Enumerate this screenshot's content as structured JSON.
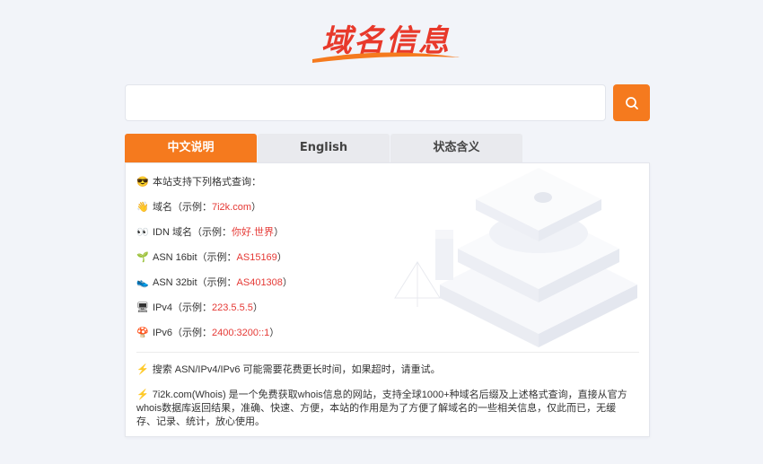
{
  "logo": {
    "text": "域名信息"
  },
  "search": {
    "placeholder": "",
    "value": ""
  },
  "tabs": [
    {
      "label": "中文说明",
      "active": true
    },
    {
      "label": "English",
      "active": false
    },
    {
      "label": "状态含义",
      "active": false
    }
  ],
  "panel": {
    "intro": "本站支持下列格式查询：",
    "formats": [
      {
        "icon": "hand-icon",
        "label": "域名（示例：",
        "example": "7i2k.com",
        "suffix": "）"
      },
      {
        "icon": "eyes-icon",
        "label": "IDN 域名（示例：",
        "example": "你好.世界",
        "suffix": "）"
      },
      {
        "icon": "sprout-icon",
        "label": "ASN 16bit（示例：",
        "example": "AS15169",
        "suffix": "）"
      },
      {
        "icon": "sneaker-icon",
        "label": "ASN 32bit（示例：",
        "example": "AS401308",
        "suffix": "）"
      },
      {
        "icon": "monitor-icon",
        "label": "IPv4（示例：",
        "example": "223.5.5.5",
        "suffix": "）"
      },
      {
        "icon": "mushroom-icon",
        "label": "IPv6（示例：",
        "example": "2400:3200::1",
        "suffix": "）"
      }
    ],
    "note1": "搜索 ASN/IPv4/IPv6 可能需要花费更长时间，如果超时，请重试。",
    "note2_line1": "7i2k.com(Whois) 是一个免费获取whois信息的网站，支持全球1000+种域名后缀及上述格式查询，直接从官方",
    "note2_line2": "whois数据库返回结果，准确、快速、方便，本站的作用是为了方便了解域名的一些相关信息，仅此而已，无缓",
    "note2_line3": "存、记录、统计，放心使用。"
  },
  "colors": {
    "accent": "#f57a1e",
    "example": "#e53935",
    "logo": "#e8392b"
  }
}
